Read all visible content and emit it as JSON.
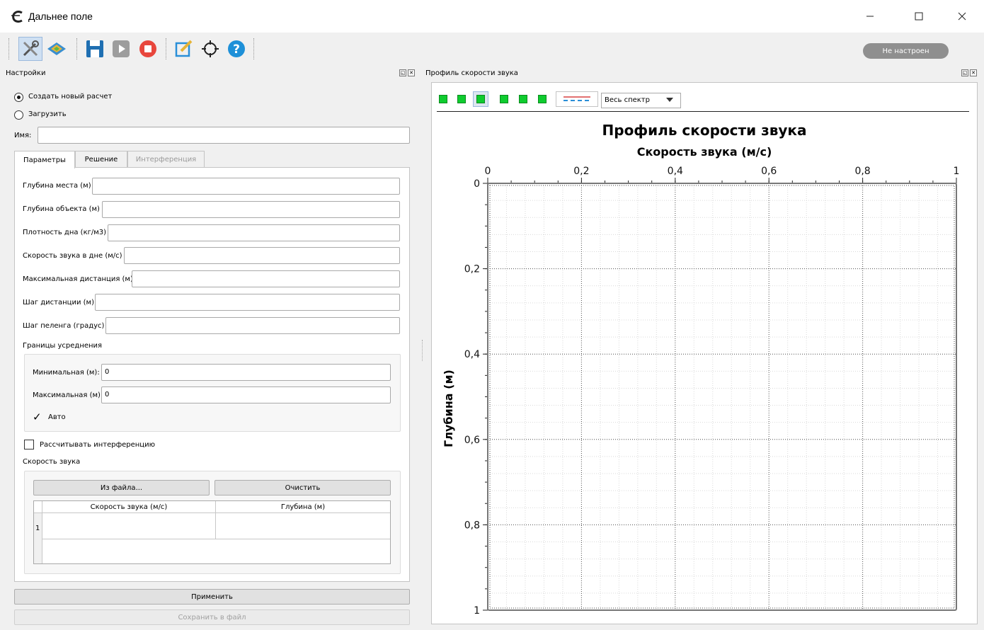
{
  "window": {
    "title": "Дальнее поле",
    "controls": [
      "minimize",
      "maximize",
      "close"
    ]
  },
  "toolbar": {
    "buttons": [
      {
        "name": "tools-icon"
      },
      {
        "name": "terrain-icon"
      },
      {
        "name": "save-icon"
      },
      {
        "name": "play-icon"
      },
      {
        "name": "stop-icon"
      },
      {
        "name": "edit-icon"
      },
      {
        "name": "target-icon"
      },
      {
        "name": "help-icon"
      }
    ],
    "status": "Не настроен"
  },
  "settings": {
    "title": "Настройки",
    "mode_options": [
      "Создать новый расчет",
      "Загрузить"
    ],
    "selected_mode": "Создать новый расчет",
    "name_label": "Имя:",
    "name_value": "",
    "tabs": [
      {
        "label": "Параметры",
        "active": true
      },
      {
        "label": "Решение",
        "active": false
      },
      {
        "label": "Интерференция",
        "active": false,
        "disabled": true
      }
    ],
    "params": [
      {
        "label": "Глубина места (м)",
        "value": ""
      },
      {
        "label": "Глубина объекта (м)",
        "value": ""
      },
      {
        "label": "Плотность дна (кг/м3)",
        "value": ""
      },
      {
        "label": "Скорость звука в дне (м/с)",
        "value": ""
      },
      {
        "label": "Максимальная дистанция (м)",
        "value": ""
      },
      {
        "label": "Шаг дистанции (м)",
        "value": ""
      },
      {
        "label": "Шаг пеленга (градус)",
        "value": ""
      }
    ],
    "averaging": {
      "title": "Границы усреднения",
      "min_label": "Минимальная (м):",
      "min_value": "0",
      "max_label": "Максимальная (м)",
      "max_value": "0",
      "auto_label": "Авто",
      "auto_checked": true
    },
    "interference_label": "Рассчитывать интерференцию",
    "interference_checked": false,
    "sound_speed": {
      "title": "Скорость звука",
      "from_file": "Из файла...",
      "clear": "Очистить",
      "columns": [
        "Скорость звука (м/с)",
        "Глубина (м)"
      ],
      "rows": [
        {
          "index": "1",
          "speed": "",
          "depth": ""
        }
      ]
    },
    "apply": "Применить",
    "save_to_file": "Сохранить в файл"
  },
  "profile_panel": {
    "title": "Профиль скорости звука",
    "plot_tools": [
      "zoom-fit-icon",
      "zoom-in-icon",
      "autoscale-icon",
      "pan-icon",
      "zoom-out-icon",
      "reset-icon"
    ],
    "line_style": "line-style-icon",
    "spectrum_select": "Весь спектр"
  },
  "chart_data": {
    "type": "line",
    "title": "Профиль скорости звука",
    "xlabel": "Скорость звука (м/с)",
    "ylabel": "Глубина (м)",
    "xlim": [
      0,
      1
    ],
    "ylim": [
      0,
      1
    ],
    "y_inverted": true,
    "x_axis_position": "top",
    "x_ticks": [
      "0",
      "0,2",
      "0,4",
      "0,6",
      "0,8",
      "1"
    ],
    "y_ticks": [
      "0",
      "0,2",
      "0,4",
      "0,6",
      "0,8",
      "1"
    ],
    "grid": true,
    "series": []
  },
  "colors": {
    "plot_tool_green": "#0fcc2f",
    "status_pill": "#8f8f8f"
  }
}
